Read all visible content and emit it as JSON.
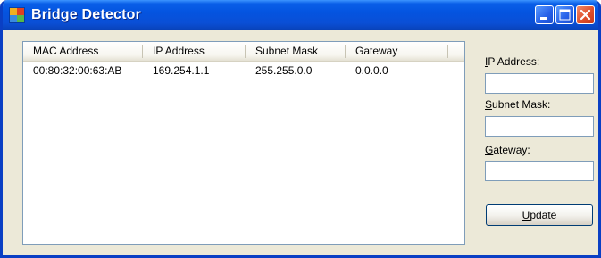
{
  "window": {
    "title": "Bridge Detector"
  },
  "list": {
    "columns": [
      "MAC Address",
      "IP Address",
      "Subnet Mask",
      "Gateway"
    ],
    "rows": [
      [
        "00:80:32:00:63:AB",
        "169.254.1.1",
        "255.255.0.0",
        "0.0.0.0"
      ]
    ]
  },
  "form": {
    "ip_label_first": "I",
    "ip_label_rest": "P Address:",
    "ip_value": "",
    "subnet_label_first": "S",
    "subnet_label_rest": "ubnet Mask:",
    "subnet_value": "",
    "gateway_label_first": "G",
    "gateway_label_rest": "ateway:",
    "gateway_value": "",
    "update_label_first": "U",
    "update_label_rest": "pdate"
  },
  "colors": {
    "titlebar": "#0454e0",
    "close_button": "#e0502c",
    "face": "#ece9d8"
  },
  "icons": {
    "app": "app-icon",
    "minimize": "minimize-icon",
    "maximize": "maximize-icon",
    "close": "close-icon"
  }
}
